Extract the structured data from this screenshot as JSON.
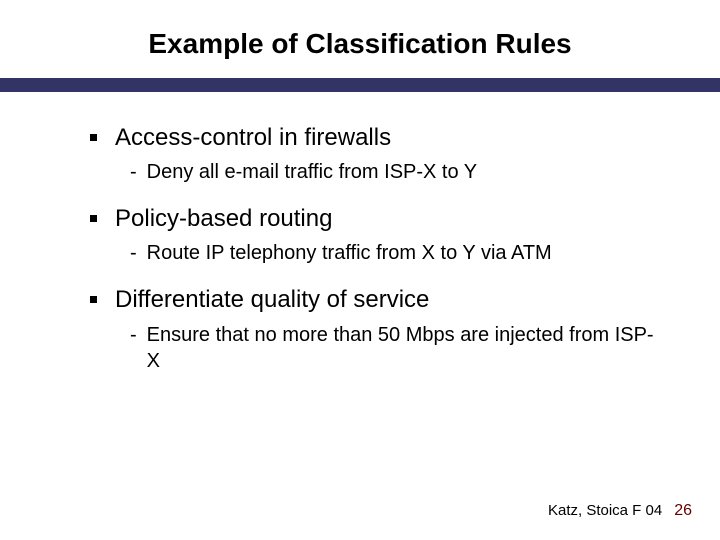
{
  "title": "Example of Classification Rules",
  "items": [
    {
      "heading": "Access-control in firewalls",
      "sub": "Deny all e-mail traffic from ISP-X to Y"
    },
    {
      "heading": "Policy-based routing",
      "sub": "Route IP telephony traffic from X to Y via ATM"
    },
    {
      "heading": "Differentiate quality of service",
      "sub": "Ensure that no more than 50 Mbps are injected from ISP-X"
    }
  ],
  "footer": {
    "label": "Katz, Stoica F 04",
    "page": "26"
  }
}
